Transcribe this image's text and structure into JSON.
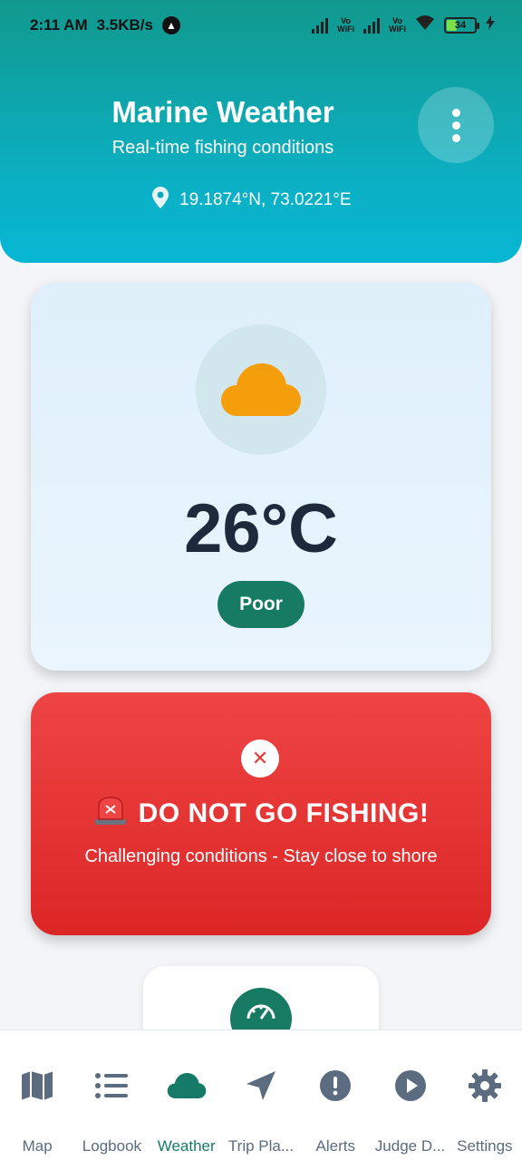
{
  "status_bar": {
    "time": "2:11 AM",
    "net_speed": "3.5KB/s",
    "volte1": "Vo\nWiFi",
    "volte2": "Vo\nWiFi",
    "battery": "34"
  },
  "header": {
    "title": "Marine Weather",
    "subtitle": "Real-time fishing conditions",
    "coordinates": "19.1874°N, 73.0221°E"
  },
  "weather": {
    "icon": "cloud-icon",
    "temperature": "26°C",
    "condition_badge": "Poor"
  },
  "alert": {
    "title": "DO NOT GO FISHING!",
    "message": "Challenging conditions - Stay close to shore"
  },
  "nav": {
    "items": [
      {
        "label": "Map",
        "icon": "map-icon"
      },
      {
        "label": "Logbook",
        "icon": "list-icon"
      },
      {
        "label": "Weather",
        "icon": "cloud-icon",
        "active": true
      },
      {
        "label": "Trip Pla...",
        "icon": "navigation-icon"
      },
      {
        "label": "Alerts",
        "icon": "alert-icon"
      },
      {
        "label": "Judge D...",
        "icon": "play-icon"
      },
      {
        "label": "Settings",
        "icon": "gear-icon"
      }
    ]
  },
  "colors": {
    "header_start": "#11998e",
    "header_end": "#06b6d4",
    "accent": "#177a63",
    "alert_red": "#dc2626",
    "cloud": "#f59e0b"
  }
}
